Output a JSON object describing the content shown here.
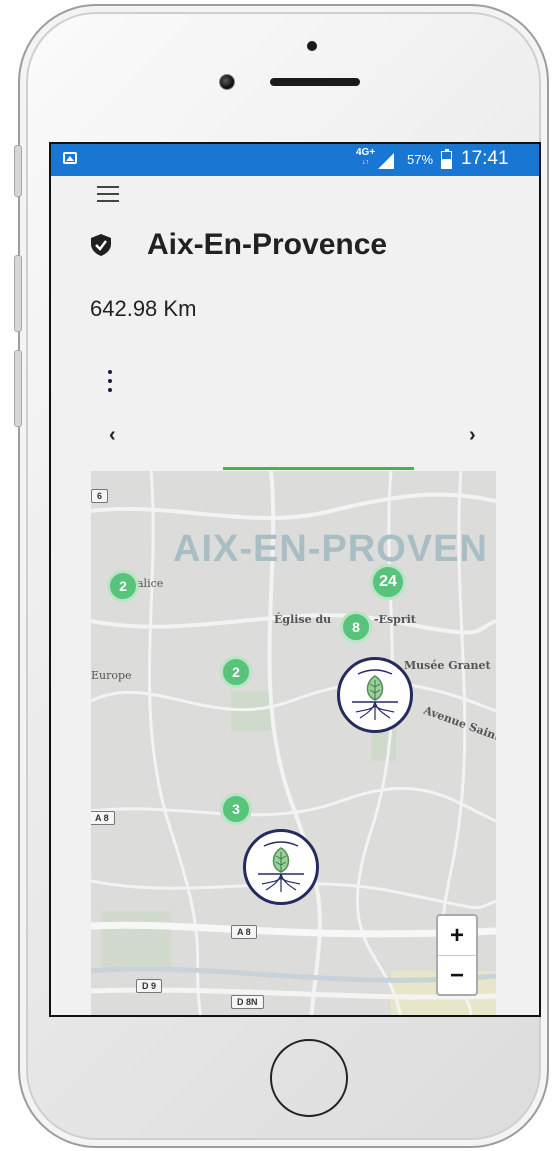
{
  "status": {
    "network": "4G+",
    "network_sub": "↓↑",
    "battery": "57%",
    "time": "17:41"
  },
  "header": {
    "title": "Aix-En-Provence",
    "distance": "642.98 Km"
  },
  "nav": {
    "prev": "‹",
    "next": "›"
  },
  "map": {
    "city_label": "AIX-EN-PROVEN",
    "places": [
      "Église du",
      "-Esprit",
      "Musée Granet",
      "Avenue Saint-Jér",
      "Europe",
      "alice"
    ],
    "clusters": [
      "2",
      "24",
      "8",
      "2",
      "3"
    ],
    "road_tags": [
      "6",
      "A 8",
      "A 8",
      "D 9",
      "D 8N"
    ],
    "zoom_in": "+",
    "zoom_out": "−"
  },
  "colors": {
    "status_bar": "#1976d2",
    "accent_green": "#4caf50",
    "cluster": "#58c37b",
    "marker_ring": "#262b5e"
  }
}
